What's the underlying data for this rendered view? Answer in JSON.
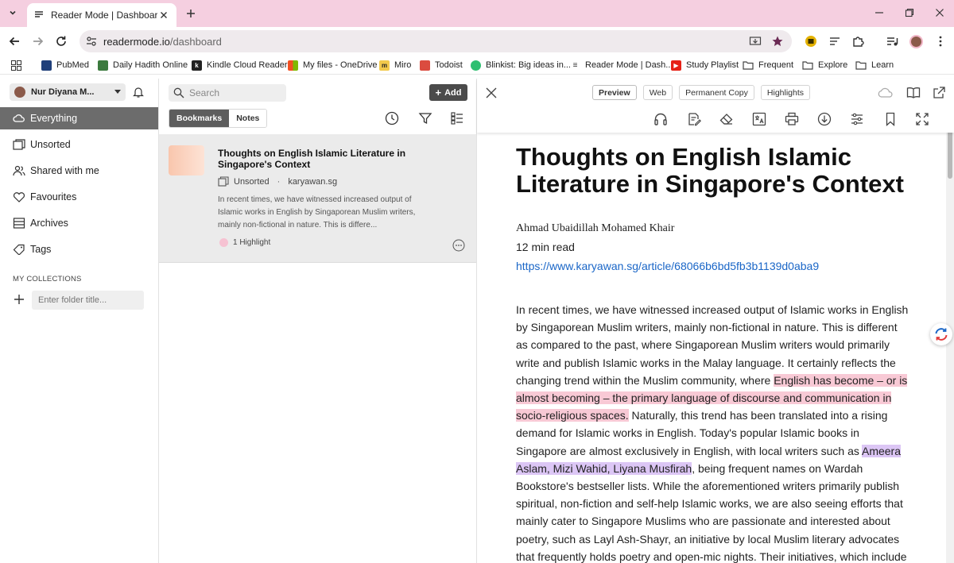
{
  "browser": {
    "tab_title": "Reader Mode | Dashboard",
    "url_host": "readermode.io",
    "url_path": "/dashboard"
  },
  "bookmarks": [
    {
      "label": "PubMed",
      "color": "#1f3f7a"
    },
    {
      "label": "Daily Hadith Online",
      "color": "#3b7a3e"
    },
    {
      "label": "Kindle Cloud Reader",
      "color": "#222222"
    },
    {
      "label": "My files - OneDrive",
      "color": "#0078d4"
    },
    {
      "label": "Miro",
      "color": "#f2c94c"
    },
    {
      "label": "Todoist",
      "color": "#db4c3f"
    },
    {
      "label": "Blinkist: Big ideas in...",
      "color": "#2fbf71"
    },
    {
      "label": "Reader Mode | Dash...",
      "color": "#444444"
    },
    {
      "label": "Study Playlist",
      "color": "#e62117"
    },
    {
      "label": "Frequent",
      "color": "#444444"
    },
    {
      "label": "Explore",
      "color": "#444444"
    },
    {
      "label": "Learn",
      "color": "#444444"
    }
  ],
  "sidebar": {
    "user_name": "Nur Diyana M...",
    "items": [
      {
        "label": "Everything",
        "icon": "cloud-icon",
        "active": true
      },
      {
        "label": "Unsorted",
        "icon": "cards-icon"
      },
      {
        "label": "Shared with me",
        "icon": "people-icon"
      },
      {
        "label": "Favourites",
        "icon": "heart-icon"
      },
      {
        "label": "Archives",
        "icon": "archive-icon"
      },
      {
        "label": "Tags",
        "icon": "tag-icon"
      }
    ],
    "collections_label": "MY COLLECTIONS",
    "folder_placeholder": "Enter folder title..."
  },
  "list": {
    "search_placeholder": "Search",
    "add_label": "Add",
    "tabs": [
      "Bookmarks",
      "Notes"
    ],
    "active_tab": "Bookmarks",
    "card": {
      "title": "Thoughts on English Islamic Literature in Singapore's Context",
      "collection": "Unsorted",
      "separator": "·",
      "domain": "karyawan.sg",
      "excerpt": "In recent times, we have witnessed increased output of Islamic works in English by Singaporean Muslim writers, mainly non-fictional in nature. This is differe...",
      "highlights": "1 Highlight"
    }
  },
  "reader": {
    "tabs": [
      "Preview",
      "Web",
      "Permanent Copy",
      "Highlights"
    ],
    "active_tab": "Preview",
    "title": "Thoughts on English Islamic Literature in Singapore's Context",
    "author": "Ahmad Ubaidillah Mohamed Khair",
    "read_time": "12 min read",
    "link": "https://www.karyawan.sg/article/68066b6bd5fb3b1139d0aba9",
    "body": {
      "p1": "In recent times, we have witnessed increased output of Islamic works in English by Singaporean Muslim writers, mainly non-fictional in nature. This is different as compared to the past, where Singaporean Muslim writers would primarily write and publish Islamic works in the Malay language. It certainly reflects the changing trend within the Muslim community, where ",
      "hl1": "English has become – or is almost becoming – the primary language of discourse and communication in socio-religious spaces.",
      "p2": " Naturally, this trend has been translated into a rising demand for Islamic works in English. Today's popular Islamic books in Singapore are almost exclusively in English, with local writers such as ",
      "hl2": "Ameera Aslam, Mizi Wahid, Liyana Musfirah",
      "p3": ", being frequent names on Wardah Bookstore's bestseller lists. While the aforementioned writers primarily publish spiritual, non-fiction and self-help Islamic works, we are also seeing efforts that mainly cater to Singapore Muslims who are passionate and interested about poetry, such as Layl Ash-Shayr, an initiative by local Muslim literary advocates that frequently holds poetry and open-mic nights. Their initiatives, which include an anthology and poetry"
    }
  },
  "colors": {
    "tabstrip": "#f5cfe0",
    "highlight_pink": "#f8c9d5",
    "highlight_purple": "#dcc6f5",
    "link": "#1a66c7",
    "active_nav": "#6c6c6c"
  }
}
